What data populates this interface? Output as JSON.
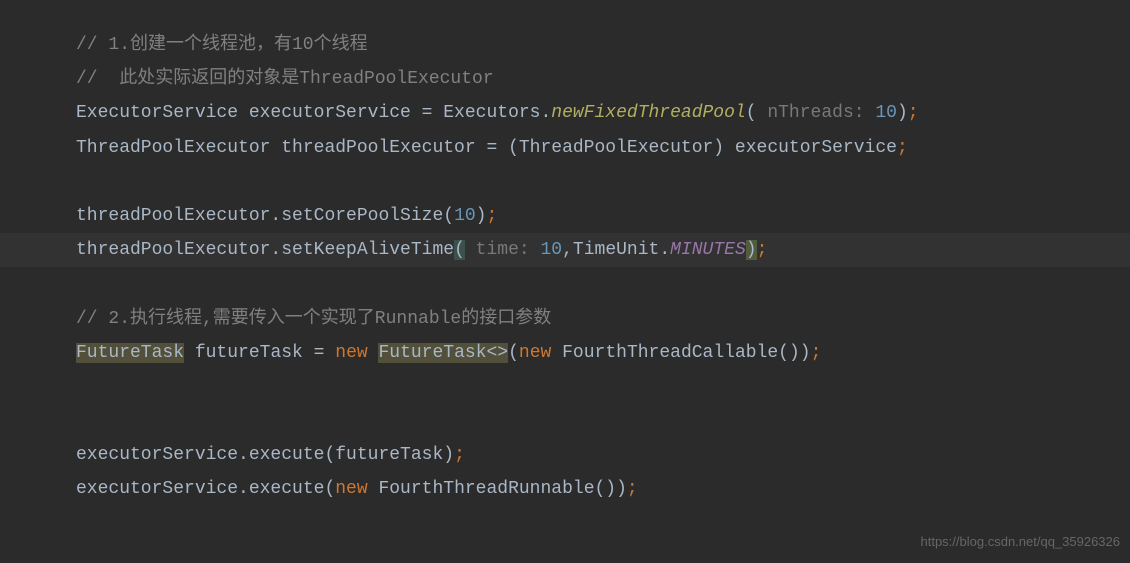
{
  "code": {
    "line1_comment": "// 1.创建一个线程池，有10个线程",
    "line2_comment": "//  此处实际返回的对象是ThreadPoolExecutor",
    "line3_part1": "ExecutorService executorService = Executors.",
    "line3_method": "newFixedThreadPool",
    "line3_paren_open": "(",
    "line3_hint": " nThreads: ",
    "line3_number": "10",
    "line3_paren_close": ")",
    "line3_semi": ";",
    "line4_text": "ThreadPoolExecutor threadPoolExecutor = (ThreadPoolExecutor) executorService",
    "line4_semi": ";",
    "line6_part1": "threadPoolExecutor.setCorePoolSize(",
    "line6_number": "10",
    "line6_part2": ")",
    "line6_semi": ";",
    "line7_part1": "threadPoolExecutor.setKeepAliveTime",
    "line7_paren_open": "(",
    "line7_hint": " time: ",
    "line7_number": "10",
    "line7_part2": ",TimeUnit.",
    "line7_constant": "MINUTES",
    "line7_paren_close": ")",
    "line7_semi": ";",
    "line9_comment": "// 2.执行线程,需要传入一个实现了Runnable的接口参数",
    "line10_type1": "FutureTask",
    "line10_part1": " futureTask = ",
    "line10_new1": "new",
    "line10_space1": " ",
    "line10_type2": "FutureTask<>",
    "line10_paren1": "(",
    "line10_new2": "new",
    "line10_part2": " FourthThreadCallable())",
    "line10_semi": ";",
    "line13_part1": "executorService.execute(futureTask)",
    "line13_semi": ";",
    "line14_part1": "executorService.execute(",
    "line14_new": "new",
    "line14_part2": " FourthThreadRunnable())",
    "line14_semi": ";"
  },
  "watermark": "https://blog.csdn.net/qq_35926326"
}
